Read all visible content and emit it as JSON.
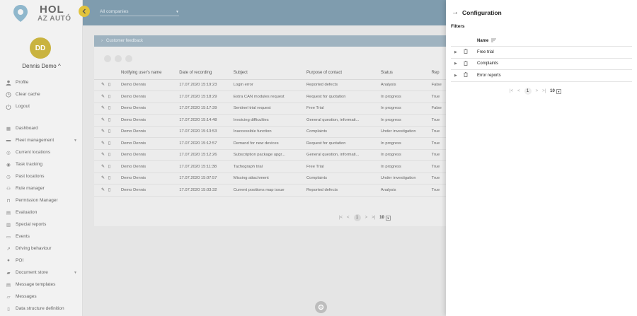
{
  "brand": {
    "line1": "HOL",
    "line2": "AZ AUTÓ"
  },
  "user": {
    "initials": "DD",
    "name": "Dennis Demo"
  },
  "account_menu": [
    {
      "label": "Profile",
      "icon": "person-icon"
    },
    {
      "label": "Clear cache",
      "icon": "history-icon"
    },
    {
      "label": "Logout",
      "icon": "power-icon"
    }
  ],
  "nav": [
    {
      "label": "Dashboard",
      "icon": "dashboard-icon"
    },
    {
      "label": "Fleet management",
      "icon": "truck-icon",
      "expandable": true
    },
    {
      "label": "Current locations",
      "icon": "location-icon"
    },
    {
      "label": "Task tracking",
      "icon": "target-icon"
    },
    {
      "label": "Past locations",
      "icon": "clock-icon"
    },
    {
      "label": "Rule manager",
      "icon": "rule-icon"
    },
    {
      "label": "Permission Manager",
      "icon": "lock-icon"
    },
    {
      "label": "Evaluation",
      "icon": "chart-icon"
    },
    {
      "label": "Special reports",
      "icon": "report-icon"
    },
    {
      "label": "Events",
      "icon": "calendar-icon"
    },
    {
      "label": "Driving behaviour",
      "icon": "trend-icon"
    },
    {
      "label": "POI",
      "icon": "pin-icon"
    },
    {
      "label": "Document store",
      "icon": "folder-icon",
      "expandable": true
    },
    {
      "label": "Message templates",
      "icon": "template-icon"
    },
    {
      "label": "Messages",
      "icon": "message-icon"
    },
    {
      "label": "Data structure definition",
      "icon": "document-icon"
    }
  ],
  "topbar": {
    "company_select": "All companies"
  },
  "main": {
    "card_header": "Customer feedback",
    "columns": [
      "Notifying user's name",
      "Date of recording",
      "Subject",
      "Purpose of contact",
      "Status",
      "Rep"
    ],
    "rows": [
      [
        "Demo Dennis",
        "17.07.2020 15:19:23",
        "Login error",
        "Reported defects",
        "Analysis",
        "False"
      ],
      [
        "Demo Dennis",
        "17.07.2020 15:18:29",
        "Extra CAN modules request",
        "Request for quotation",
        "In progress",
        "True"
      ],
      [
        "Demo Dennis",
        "17.07.2020 15:17:39",
        "Sentinel trial request",
        "Free Trial",
        "In progress",
        "False"
      ],
      [
        "Demo Dennis",
        "17.07.2020 15:14:48",
        "Invoicing difficulties",
        "General question, informati...",
        "In progress",
        "True"
      ],
      [
        "Demo Dennis",
        "17.07.2020 15:13:53",
        "Inaccessible function",
        "Complaints",
        "Under investigation",
        "True"
      ],
      [
        "Demo Dennis",
        "17.07.2020 15:12:57",
        "Demand for new devices",
        "Request for quotation",
        "In progress",
        "True"
      ],
      [
        "Demo Dennis",
        "17.07.2020 15:12:26",
        "Subscription package upgr...",
        "General question, informati...",
        "In progress",
        "True"
      ],
      [
        "Demo Dennis",
        "17.07.2020 15:11:38",
        "Tachograph trial",
        "Free Trial",
        "In progress",
        "True"
      ],
      [
        "Demo Dennis",
        "17.07.2020 15:07:57",
        "Missing attachment",
        "Complaints",
        "Under investigation",
        "True"
      ],
      [
        "Demo Dennis",
        "17.07.2020 15:03:32",
        "Current positions map issue",
        "Reported defects",
        "Analysis",
        "True"
      ]
    ],
    "pager": {
      "first": "|<",
      "prev": "<",
      "page": "1",
      "next": ">",
      "last": ">|",
      "size": "10"
    }
  },
  "panel": {
    "title": "Configuration",
    "filters_label": "Filters",
    "column_name": "Name",
    "items": [
      "Free trial",
      "Complaints",
      "Error reports"
    ],
    "pager": {
      "first": "|<",
      "prev": "<",
      "page": "1",
      "next": ">",
      "last": ">|",
      "size": "10"
    }
  },
  "colors": {
    "accent": "#e1c33c",
    "topbar": "#7f9cae",
    "card_header": "#9fb3c0"
  }
}
